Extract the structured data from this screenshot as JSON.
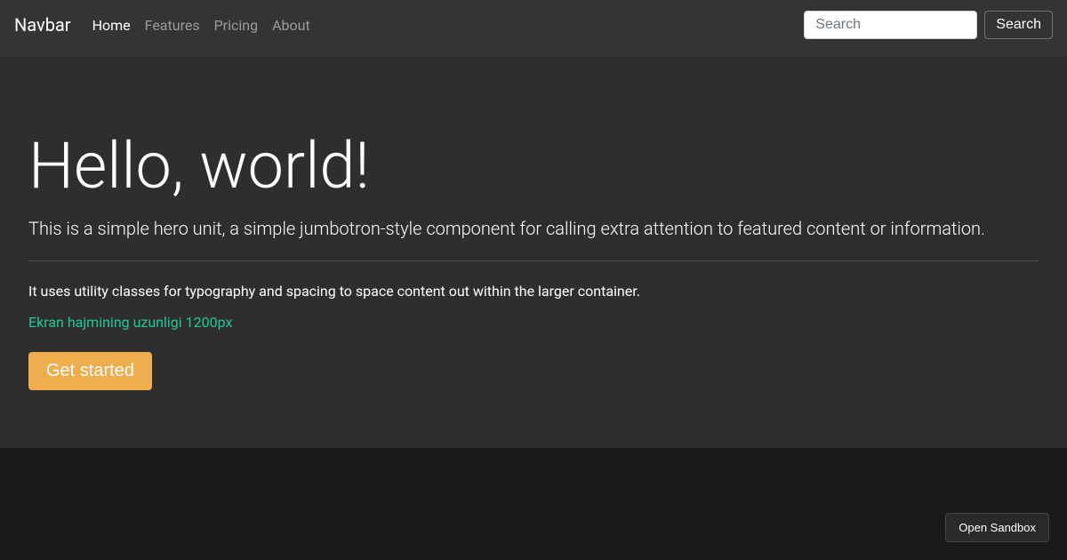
{
  "navbar": {
    "brand": "Navbar",
    "links": {
      "home": "Home",
      "features": "Features",
      "pricing": "Pricing",
      "about": "About"
    },
    "search": {
      "placeholder": "Search",
      "buttonLabel": "Search"
    }
  },
  "jumbotron": {
    "heading": "Hello, world!",
    "lead": "This is a simple hero unit, a simple jumbotron-style component for calling extra attention to featured content or information.",
    "body": "It uses utility classes for typography and spacing to space content out within the larger container.",
    "info": "Ekran hajmining uzunligi 1200px",
    "ctaLabel": "Get started"
  },
  "sandbox": {
    "openLabel": "Open Sandbox"
  }
}
